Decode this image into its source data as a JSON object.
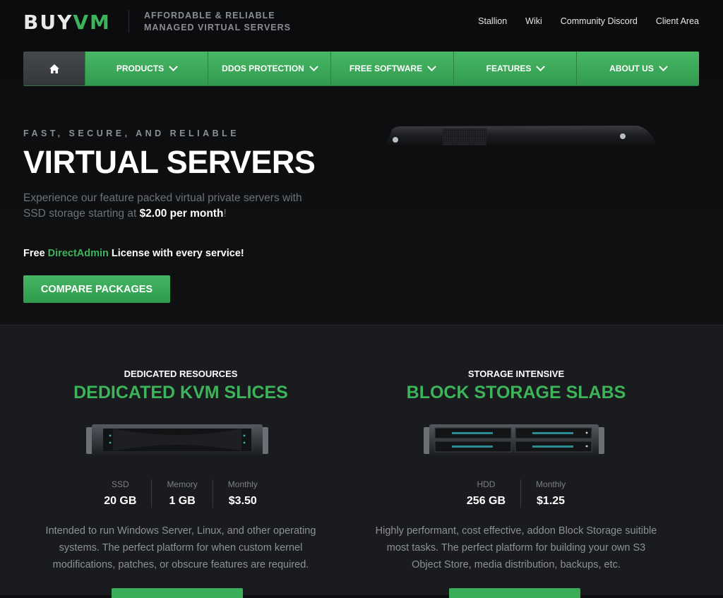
{
  "brand": {
    "logo_part1": "BUY",
    "logo_part2": "VM",
    "tagline_line1": "AFFORDABLE & RELIABLE",
    "tagline_line2": "MANAGED VIRTUAL SERVERS"
  },
  "top_links": [
    "Stallion",
    "Wiki",
    "Community Discord",
    "Client Area"
  ],
  "nav": {
    "home_icon": "home-icon",
    "items": [
      "PRODUCTS",
      "DDOS PROTECTION",
      "FREE SOFTWARE",
      "FEATURES",
      "ABOUT US"
    ]
  },
  "hero": {
    "eyebrow": "FAST, SECURE, AND RELIABLE",
    "title": "VIRTUAL SERVERS",
    "desc_line1": "Experience our feature packed virtual private servers with",
    "desc_line2_prefix": "SSD storage starting at",
    "desc_price": "$2.00 per month",
    "desc_suffix": "!",
    "free_prefix": "Free",
    "free_highlight": "DirectAdmin",
    "free_suffix": "License with every service!",
    "cta_label": "COMPARE PACKAGES"
  },
  "cards": [
    {
      "kicker": "DEDICATED RESOURCES",
      "title": "DEDICATED KVM SLICES",
      "specs": [
        {
          "label": "SSD",
          "value": "20 GB"
        },
        {
          "label": "Memory",
          "value": "1 GB"
        },
        {
          "label": "Monthly",
          "value": "$3.50"
        }
      ],
      "desc_line1": "Intended to run Windows Server, Linux, and other operating",
      "desc_line2": "systems. The perfect platform for when custom kernel",
      "desc_line3": "modifications, patches, or obscure features are required."
    },
    {
      "kicker": "STORAGE INTENSIVE",
      "title": "BLOCK STORAGE SLABS",
      "specs": [
        {
          "label": "HDD",
          "value": "256 GB"
        },
        {
          "label": "Monthly",
          "value": "$1.25"
        }
      ],
      "desc_line1": "Highly performant, cost effective, addon Block Storage suitible",
      "desc_line2": "most tasks. The perfect platform for building your own S3",
      "desc_line3": "Object Store, media distribution, backups, etc."
    }
  ],
  "colors": {
    "accent": "#3db35a",
    "background": "#0d0e10",
    "section_bg": "#1a1b1e"
  }
}
